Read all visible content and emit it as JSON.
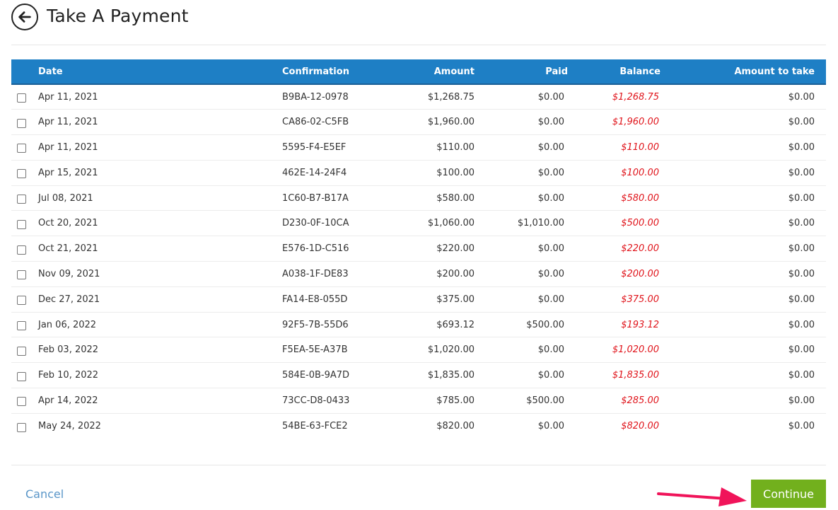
{
  "header": {
    "title": "Take A Payment",
    "back_icon": "arrow-left-circle-icon"
  },
  "table": {
    "columns": {
      "date": "Date",
      "confirmation": "Confirmation",
      "amount": "Amount",
      "paid": "Paid",
      "balance": "Balance",
      "amount_to_take": "Amount to take"
    },
    "rows": [
      {
        "date": "Apr 11, 2021",
        "confirmation": "B9BA-12-0978",
        "amount": "$1,268.75",
        "paid": "$0.00",
        "balance": "$1,268.75",
        "amount_to_take": "$0.00"
      },
      {
        "date": "Apr 11, 2021",
        "confirmation": "CA86-02-C5FB",
        "amount": "$1,960.00",
        "paid": "$0.00",
        "balance": "$1,960.00",
        "amount_to_take": "$0.00"
      },
      {
        "date": "Apr 11, 2021",
        "confirmation": "5595-F4-E5EF",
        "amount": "$110.00",
        "paid": "$0.00",
        "balance": "$110.00",
        "amount_to_take": "$0.00"
      },
      {
        "date": "Apr 15, 2021",
        "confirmation": "462E-14-24F4",
        "amount": "$100.00",
        "paid": "$0.00",
        "balance": "$100.00",
        "amount_to_take": "$0.00"
      },
      {
        "date": "Jul 08, 2021",
        "confirmation": "1C60-B7-B17A",
        "amount": "$580.00",
        "paid": "$0.00",
        "balance": "$580.00",
        "amount_to_take": "$0.00"
      },
      {
        "date": "Oct 20, 2021",
        "confirmation": "D230-0F-10CA",
        "amount": "$1,060.00",
        "paid": "$1,010.00",
        "balance": "$500.00",
        "amount_to_take": "$0.00"
      },
      {
        "date": "Oct 21, 2021",
        "confirmation": "E576-1D-C516",
        "amount": "$220.00",
        "paid": "$0.00",
        "balance": "$220.00",
        "amount_to_take": "$0.00"
      },
      {
        "date": "Nov 09, 2021",
        "confirmation": "A038-1F-DE83",
        "amount": "$200.00",
        "paid": "$0.00",
        "balance": "$200.00",
        "amount_to_take": "$0.00"
      },
      {
        "date": "Dec 27, 2021",
        "confirmation": "FA14-E8-055D",
        "amount": "$375.00",
        "paid": "$0.00",
        "balance": "$375.00",
        "amount_to_take": "$0.00"
      },
      {
        "date": "Jan 06, 2022",
        "confirmation": "92F5-7B-55D6",
        "amount": "$693.12",
        "paid": "$500.00",
        "balance": "$193.12",
        "amount_to_take": "$0.00"
      },
      {
        "date": "Feb 03, 2022",
        "confirmation": "F5EA-5E-A37B",
        "amount": "$1,020.00",
        "paid": "$0.00",
        "balance": "$1,020.00",
        "amount_to_take": "$0.00"
      },
      {
        "date": "Feb 10, 2022",
        "confirmation": "584E-0B-9A7D",
        "amount": "$1,835.00",
        "paid": "$0.00",
        "balance": "$1,835.00",
        "amount_to_take": "$0.00"
      },
      {
        "date": "Apr 14, 2022",
        "confirmation": "73CC-D8-0433",
        "amount": "$785.00",
        "paid": "$500.00",
        "balance": "$285.00",
        "amount_to_take": "$0.00"
      },
      {
        "date": "May 24, 2022",
        "confirmation": "54BE-63-FCE2",
        "amount": "$820.00",
        "paid": "$0.00",
        "balance": "$820.00",
        "amount_to_take": "$0.00"
      }
    ]
  },
  "footer": {
    "cancel_label": "Cancel",
    "continue_label": "Continue"
  },
  "colors": {
    "header_bg": "#1e7fc5",
    "balance_text": "#e0141b",
    "continue_bg": "#72b01d",
    "cancel_link": "#5a96c8",
    "annotation_arrow": "#f0145a"
  }
}
